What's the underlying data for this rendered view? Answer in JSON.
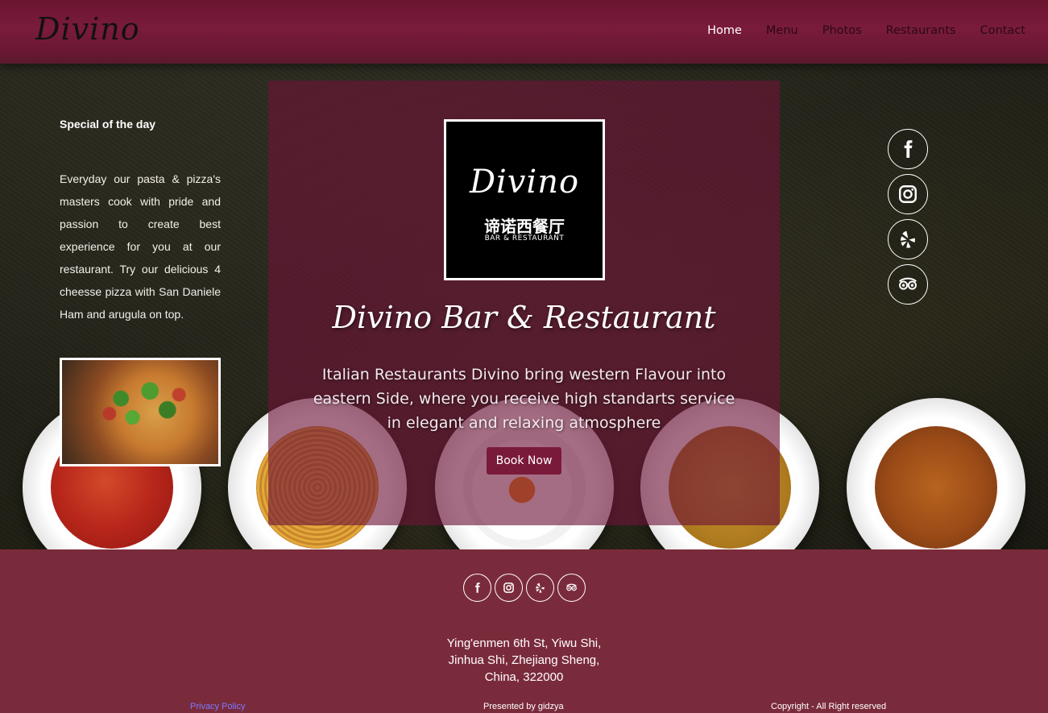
{
  "header": {
    "brand": "Divino",
    "nav": [
      {
        "label": "Home",
        "active": true
      },
      {
        "label": "Menu",
        "active": false
      },
      {
        "label": "Photos",
        "active": false
      },
      {
        "label": "Restaurants",
        "active": false
      },
      {
        "label": "Contact",
        "active": false
      }
    ]
  },
  "special": {
    "title": "Special of the day",
    "text": "Everyday our pasta & pizza's masters cook with pride and passion to create best experience for you at our restaurant. Try our delicious 4 cheesse pizza with San Daniele Ham and arugula on top."
  },
  "hero": {
    "logo_script": "Divino",
    "logo_cn": "谛诺西餐厅",
    "logo_sub": "BAR & RESTAURANT",
    "title": "Divino Bar & Restaurant",
    "description": "Italian Restaurants Divino bring western Flavour into eastern Side, where you receive high standarts service in elegant and relaxing atmosphere",
    "book_button": "Book Now"
  },
  "social": [
    "facebook-icon",
    "instagram-icon",
    "yelp-icon",
    "tripadvisor-icon"
  ],
  "footer": {
    "address_lines": [
      "Ying'enmen 6th St, Yiwu Shi,",
      "Jinhua Shi, Zhejiang Sheng,",
      "China, 322000"
    ],
    "privacy": "Privacy Policy",
    "presented": "Presented by gidzya",
    "copyright": "Copyright - All Right reserved"
  },
  "colors": {
    "accent": "#7a1a3b",
    "footer": "#7a2b3b",
    "panel": "#6e1437"
  }
}
